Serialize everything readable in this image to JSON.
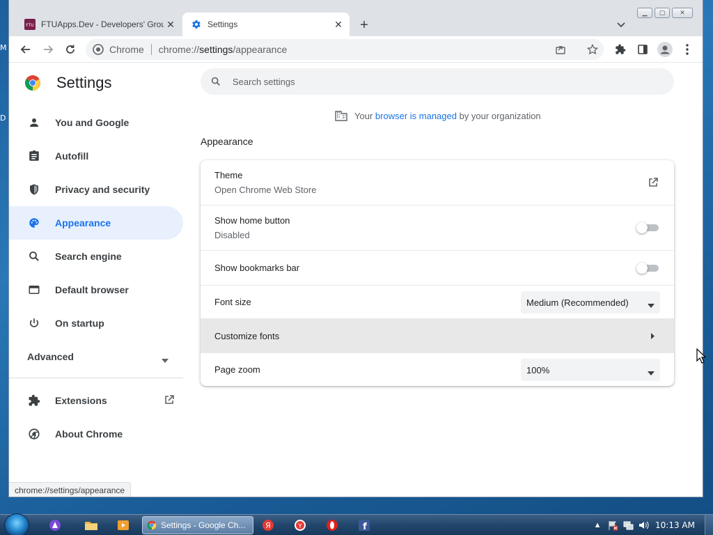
{
  "desktop": {
    "frag_top": "M",
    "frag_mid": "D"
  },
  "browser": {
    "tabs": [
      {
        "title": "FTUApps.Dev - Developers' Grou",
        "favicon_text": "FTU",
        "active": false
      },
      {
        "title": "Settings",
        "active": true
      }
    ],
    "omnibox": {
      "site_label": "Chrome",
      "url_scheme": "chrome://",
      "url_host": "settings",
      "url_path": "/appearance"
    },
    "status_url": "chrome://settings/appearance"
  },
  "settings": {
    "brand": "Settings",
    "search_placeholder": "Search settings",
    "managed": {
      "prefix": "Your ",
      "link": "browser is managed",
      "suffix": " by your organization"
    },
    "sidebar": {
      "items": [
        {
          "label": "You and Google",
          "icon": "person-icon"
        },
        {
          "label": "Autofill",
          "icon": "clipboard-icon"
        },
        {
          "label": "Privacy and security",
          "icon": "shield-icon"
        },
        {
          "label": "Appearance",
          "icon": "palette-icon",
          "selected": true
        },
        {
          "label": "Search engine",
          "icon": "search-icon"
        },
        {
          "label": "Default browser",
          "icon": "browser-icon"
        },
        {
          "label": "On startup",
          "icon": "power-icon"
        }
      ],
      "advanced": "Advanced",
      "extensions": "Extensions",
      "about": "About Chrome"
    },
    "appearance": {
      "section_title": "Appearance",
      "theme": {
        "label": "Theme",
        "sub": "Open Chrome Web Store"
      },
      "home_button": {
        "label": "Show home button",
        "sub": "Disabled",
        "enabled": false
      },
      "bookmarks_bar": {
        "label": "Show bookmarks bar",
        "enabled": false
      },
      "font_size": {
        "label": "Font size",
        "value": "Medium (Recommended)"
      },
      "customize_fonts": {
        "label": "Customize fonts"
      },
      "page_zoom": {
        "label": "Page zoom",
        "value": "100%"
      }
    }
  },
  "taskbar": {
    "chrome_task": "Settings - Google Ch...",
    "clock": "10:13 AM"
  },
  "colors": {
    "accent": "#1a73e8",
    "selected_bg": "#e8f0fe"
  }
}
